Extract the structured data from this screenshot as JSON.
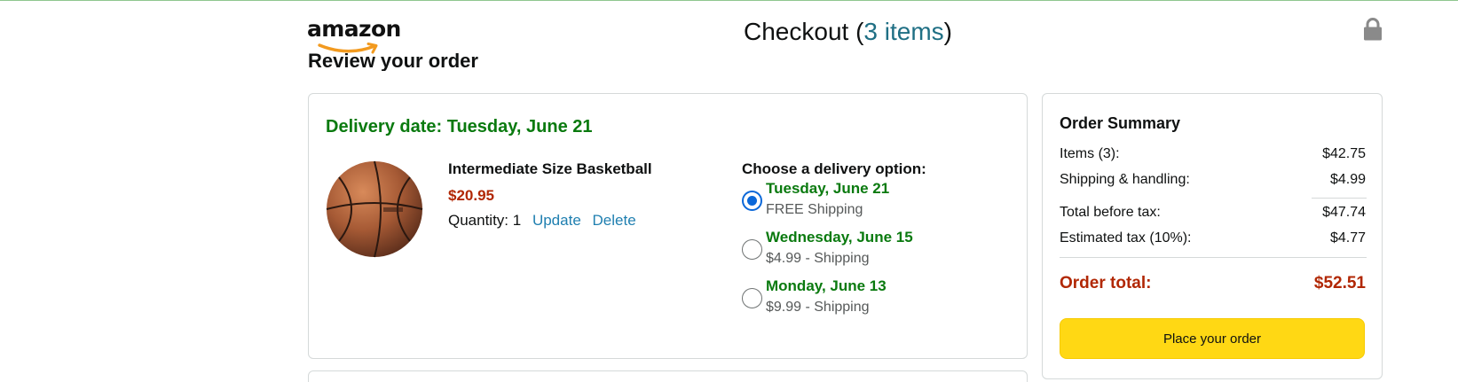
{
  "header": {
    "logo_text": "amazon",
    "title_prefix": "Checkout (",
    "items_link": "3 items",
    "title_suffix": ")",
    "lock_icon": "lock-icon"
  },
  "section_heading": "Review your order",
  "order": {
    "delivery_date": "Delivery date: Tuesday, June 21",
    "product": {
      "image_icon": "basketball-image",
      "name": "Intermediate Size Basketball",
      "price": "$20.95",
      "quantity_label": "Quantity: 1",
      "update_label": "Update",
      "delete_label": "Delete"
    },
    "delivery_options_title": "Choose a delivery option:",
    "delivery_options": [
      {
        "date": "Tuesday, June 21",
        "shipping": "FREE Shipping",
        "selected": true
      },
      {
        "date": "Wednesday, June 15",
        "shipping": "$4.99 - Shipping",
        "selected": false
      },
      {
        "date": "Monday, June 13",
        "shipping": "$9.99 - Shipping",
        "selected": false
      }
    ]
  },
  "summary": {
    "title": "Order Summary",
    "items_label": "Items (3):",
    "items_value": "$42.75",
    "shipping_label": "Shipping & handling:",
    "shipping_value": "$4.99",
    "before_tax_label": "Total before tax:",
    "before_tax_value": "$47.74",
    "tax_label": "Estimated tax (10%):",
    "tax_value": "$4.77",
    "total_label": "Order total:",
    "total_value": "$52.51",
    "place_order_label": "Place your order"
  },
  "colors": {
    "delivery_green": "#0a7a0f",
    "price_red": "#b12704",
    "link_blue": "#1f7fb0",
    "button_yellow": "#ffd814",
    "radio_blue": "#0b68d9"
  }
}
